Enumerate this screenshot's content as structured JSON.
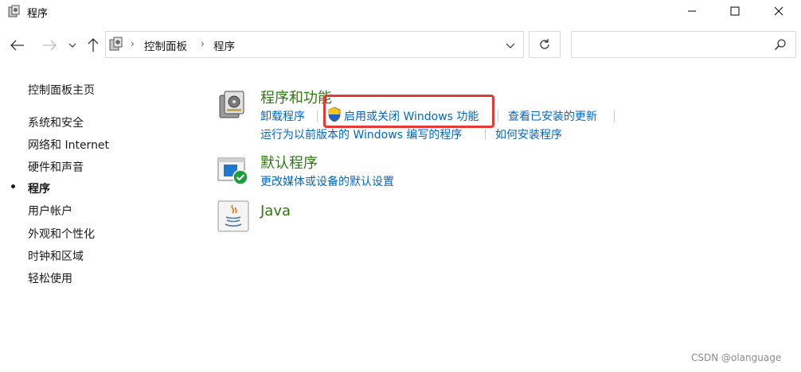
{
  "window": {
    "title": "程序",
    "minimize_icon": "minimize-icon",
    "maximize_icon": "maximize-icon",
    "close_icon": "close-icon"
  },
  "address": {
    "breadcrumbs": [
      "控制面板",
      "程序"
    ],
    "search_placeholder": ""
  },
  "sidebar": {
    "home": "控制面板主页",
    "items": [
      {
        "label": "系统和安全",
        "active": false
      },
      {
        "label": "网络和 Internet",
        "active": false
      },
      {
        "label": "硬件和声音",
        "active": false
      },
      {
        "label": "程序",
        "active": true
      },
      {
        "label": "用户帐户",
        "active": false
      },
      {
        "label": "外观和个性化",
        "active": false
      },
      {
        "label": "时钟和区域",
        "active": false
      },
      {
        "label": "轻松使用",
        "active": false
      }
    ]
  },
  "categories": [
    {
      "title": "程序和功能",
      "icon": "programs-features-icon",
      "links_row1": [
        "卸载程序",
        "启用或关闭 Windows 功能",
        "查看已安装的更新"
      ],
      "links_row2": [
        "运行为以前版本的 Windows 编写的程序",
        "如何安装程序"
      ]
    },
    {
      "title": "默认程序",
      "icon": "default-programs-icon",
      "links_row1": [
        "更改媒体或设备的默认设置"
      ]
    },
    {
      "title": "Java",
      "icon": "java-icon"
    }
  ],
  "colors": {
    "category_title": "#2b7a0b",
    "link": "#0066cc",
    "highlight": "#e53935"
  },
  "watermark": "CSDN @olanguage"
}
